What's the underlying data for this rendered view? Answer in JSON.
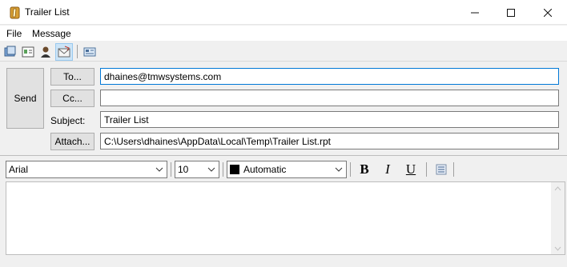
{
  "window": {
    "title": "Trailer List"
  },
  "menu": {
    "items": [
      "File",
      "Message"
    ]
  },
  "toolbar": {
    "icons": [
      "address-book-icon",
      "contact-card-icon",
      "user-icon",
      "envelope-icon",
      "properties-icon"
    ]
  },
  "compose": {
    "send_label": "Send",
    "to_label": "To...",
    "cc_label": "Cc...",
    "subject_label": "Subject:",
    "attach_label": "Attach...",
    "to_value": "dhaines@tmwsystems.com",
    "cc_value": "",
    "subject_value": "Trailer List",
    "attach_value": "C:\\Users\\dhaines\\AppData\\Local\\Temp\\Trailer List.rpt"
  },
  "format": {
    "font": "Arial",
    "size": "10",
    "color_label": "Automatic",
    "color": "#000000",
    "bold": "B",
    "italic": "I",
    "underline": "U"
  },
  "colors": {
    "accent": "#0078d7",
    "active_toolbar": "#cce4f7"
  }
}
